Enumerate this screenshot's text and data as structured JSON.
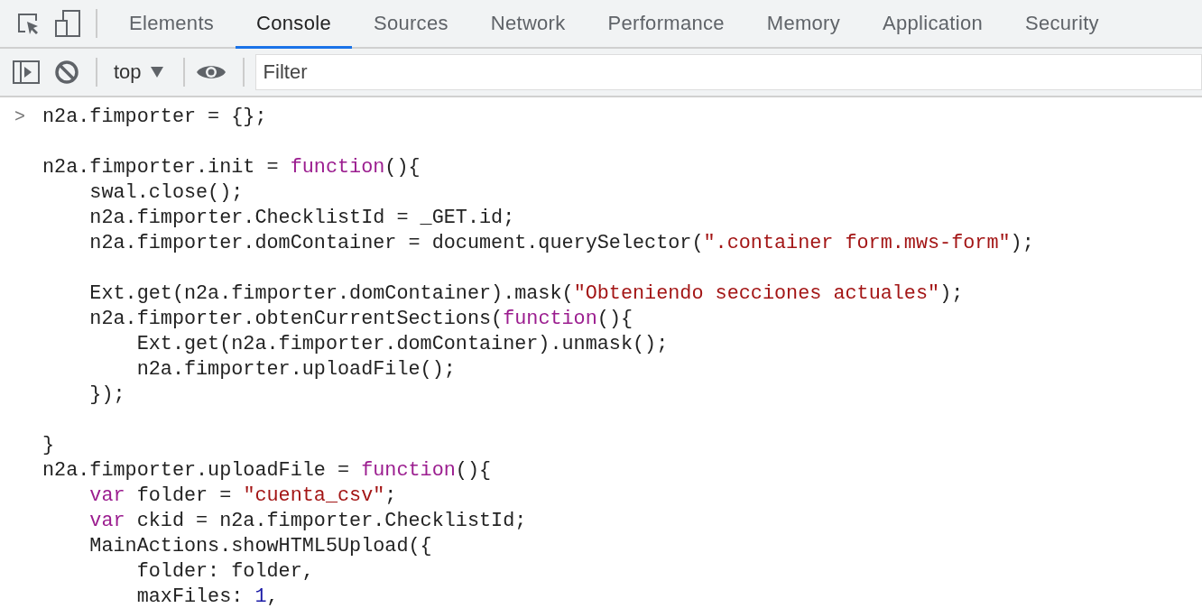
{
  "tabs": [
    {
      "label": "Elements",
      "selected": false
    },
    {
      "label": "Console",
      "selected": true
    },
    {
      "label": "Sources",
      "selected": false
    },
    {
      "label": "Network",
      "selected": false
    },
    {
      "label": "Performance",
      "selected": false
    },
    {
      "label": "Memory",
      "selected": false
    },
    {
      "label": "Application",
      "selected": false
    },
    {
      "label": "Security",
      "selected": false
    }
  ],
  "toolbar": {
    "context": "top",
    "filter": {
      "placeholder": "Filter"
    }
  },
  "prompt": ">",
  "lines": [
    {
      "kind": "code",
      "tokens": [
        {
          "kind": "plain",
          "s": "n2a.fimporter = {};"
        }
      ]
    },
    {
      "kind": "blank"
    },
    {
      "kind": "code",
      "tokens": [
        {
          "kind": "plain",
          "s": "n2a.fimporter.init = "
        },
        {
          "kind": "keyword",
          "s": "function"
        },
        {
          "kind": "plain",
          "s": "(){"
        }
      ]
    },
    {
      "kind": "code",
      "tokens": [
        {
          "kind": "plain",
          "s": "    swal.close();"
        }
      ]
    },
    {
      "kind": "code",
      "tokens": [
        {
          "kind": "plain",
          "s": "    n2a.fimporter.ChecklistId = _GET.id;"
        }
      ]
    },
    {
      "kind": "code",
      "tokens": [
        {
          "kind": "plain",
          "s": "    n2a.fimporter.domContainer = document.querySelector("
        },
        {
          "kind": "string",
          "s": "\".container form.mws-form\""
        },
        {
          "kind": "plain",
          "s": ");"
        }
      ]
    },
    {
      "kind": "blank"
    },
    {
      "kind": "code",
      "tokens": [
        {
          "kind": "plain",
          "s": "    Ext.get(n2a.fimporter.domContainer).mask("
        },
        {
          "kind": "string",
          "s": "\"Obteniendo secciones actuales\""
        },
        {
          "kind": "plain",
          "s": ");"
        }
      ]
    },
    {
      "kind": "code",
      "tokens": [
        {
          "kind": "plain",
          "s": "    n2a.fimporter.obtenCurrentSections("
        },
        {
          "kind": "keyword",
          "s": "function"
        },
        {
          "kind": "plain",
          "s": "(){"
        }
      ]
    },
    {
      "kind": "code",
      "tokens": [
        {
          "kind": "plain",
          "s": "        Ext.get(n2a.fimporter.domContainer).unmask();"
        }
      ]
    },
    {
      "kind": "code",
      "tokens": [
        {
          "kind": "plain",
          "s": "        n2a.fimporter.uploadFile();"
        }
      ]
    },
    {
      "kind": "code",
      "tokens": [
        {
          "kind": "plain",
          "s": "    });"
        }
      ]
    },
    {
      "kind": "blank"
    },
    {
      "kind": "code",
      "tokens": [
        {
          "kind": "plain",
          "s": "}"
        }
      ]
    },
    {
      "kind": "code",
      "tokens": [
        {
          "kind": "plain",
          "s": "n2a.fimporter.uploadFile = "
        },
        {
          "kind": "keyword",
          "s": "function"
        },
        {
          "kind": "plain",
          "s": "(){"
        }
      ]
    },
    {
      "kind": "code",
      "tokens": [
        {
          "kind": "keyword",
          "s": "    var"
        },
        {
          "kind": "plain",
          "s": " folder = "
        },
        {
          "kind": "string",
          "s": "\"cuenta_csv\""
        },
        {
          "kind": "plain",
          "s": ";"
        }
      ]
    },
    {
      "kind": "code",
      "tokens": [
        {
          "kind": "keyword",
          "s": "    var"
        },
        {
          "kind": "plain",
          "s": " ckid = n2a.fimporter.ChecklistId;"
        }
      ]
    },
    {
      "kind": "code",
      "tokens": [
        {
          "kind": "plain",
          "s": "    MainActions.showHTML5Upload({"
        }
      ]
    },
    {
      "kind": "code",
      "tokens": [
        {
          "kind": "plain",
          "s": "        folder: folder,"
        }
      ]
    },
    {
      "kind": "code",
      "tokens": [
        {
          "kind": "plain",
          "s": "        maxFiles: "
        },
        {
          "kind": "number",
          "s": "1"
        },
        {
          "kind": "plain",
          "s": ","
        }
      ]
    }
  ]
}
